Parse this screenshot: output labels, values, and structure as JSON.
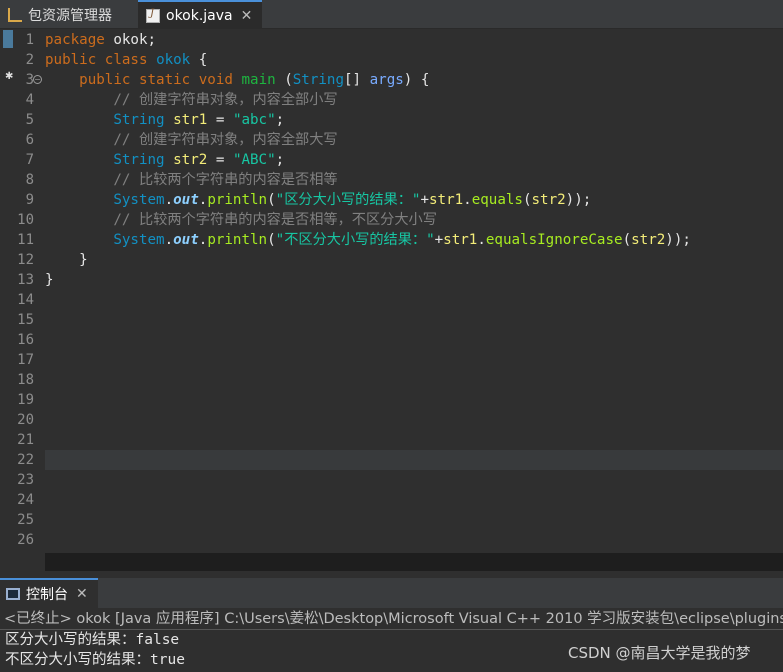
{
  "tabs": {
    "explorer": "包资源管理器",
    "file": "okok.java",
    "close": "✕"
  },
  "editor": {
    "line_numbers": [
      "1",
      "2",
      "3",
      "4",
      "5",
      "6",
      "7",
      "8",
      "9",
      "10",
      "11",
      "12",
      "13",
      "14",
      "15",
      "16",
      "17",
      "18",
      "19",
      "20",
      "21",
      "22",
      "23",
      "24",
      "25",
      "26"
    ],
    "current_line": 22,
    "code": {
      "l1": {
        "kw": "package",
        "rest": " okok;"
      },
      "l2": {
        "kw1": "public",
        "kw2": "class",
        "name": "okok",
        "rest": " {"
      },
      "l3": {
        "indent": "    ",
        "kw1": "public",
        "kw2": "static",
        "kw3": "void",
        "name": "main",
        "p1": " (",
        "type": "String",
        "p2": "[] ",
        "arg": "args",
        "p3": ") {"
      },
      "l4": {
        "indent": "        ",
        "comment": "// 创建字符串对象，内容全部小写"
      },
      "l5": {
        "indent": "        ",
        "type": "String",
        "var": "str1",
        "op": " = ",
        "str": "\"abc\"",
        "end": ";"
      },
      "l6": {
        "indent": "        ",
        "comment": "// 创建字符串对象，内容全部大写"
      },
      "l7": {
        "indent": "        ",
        "type": "String",
        "var": "str2",
        "op": " = ",
        "str": "\"ABC\"",
        "end": ";"
      },
      "l8": {
        "indent": "        ",
        "comment": "// 比较两个字符串的内容是否相等"
      },
      "l9": {
        "indent": "        ",
        "cls": "System",
        "dot1": ".",
        "out": "out",
        "dot2": ".",
        "meth": "println",
        "p1": "(",
        "str": "\"区分大小写的结果：\"",
        "plus": "+",
        "var": "str1",
        "dot3": ".",
        "meth2": "equals",
        "p2": "(",
        "var2": "str2",
        "end": "));"
      },
      "l10": {
        "indent": "        ",
        "comment": "// 比较两个字符串的内容是否相等，不区分大小写"
      },
      "l11": {
        "indent": "        ",
        "cls": "System",
        "dot1": ".",
        "out": "out",
        "dot2": ".",
        "meth": "println",
        "p1": "(",
        "str": "\"不区分大小写的结果：\"",
        "plus": "+",
        "var": "str1",
        "dot3": ".",
        "meth2": "equalsIgnoreCase",
        "p2": "(",
        "var2": "str2",
        "end": "));"
      },
      "l12": {
        "text": "    }"
      },
      "l13": {
        "text": "}"
      }
    }
  },
  "console": {
    "tab_label": "控制台",
    "status": "<已终止> okok [Java 应用程序] C:\\Users\\姜松\\Desktop\\Microsoft Visual C++ 2010 学习版安装包\\eclipse\\plugins",
    "output": [
      "区分大小写的结果：false",
      "不区分大小写的结果：true"
    ]
  },
  "watermark": "CSDN @南昌大学是我的梦"
}
